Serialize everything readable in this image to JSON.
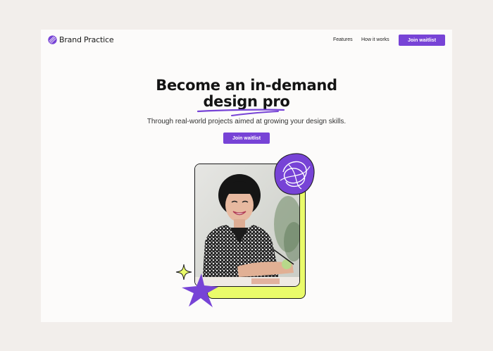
{
  "nav": {
    "brand": "Brand Practice",
    "links": [
      "Features",
      "How it works"
    ],
    "cta": "Join waitlist"
  },
  "hero": {
    "title_line1": "Become an in-demand",
    "title_line2": "design pro",
    "subtitle": "Through real-world projects aimed at growing your design skills.",
    "cta": "Join waitlist"
  },
  "colors": {
    "accent": "#7743d6",
    "highlight": "#eafb6a",
    "background": "#f2eeeb",
    "page": "#fcfbfa"
  },
  "icons": [
    "logo-mark-icon",
    "sparkle-icon",
    "star-icon",
    "scribble-blob-icon"
  ]
}
